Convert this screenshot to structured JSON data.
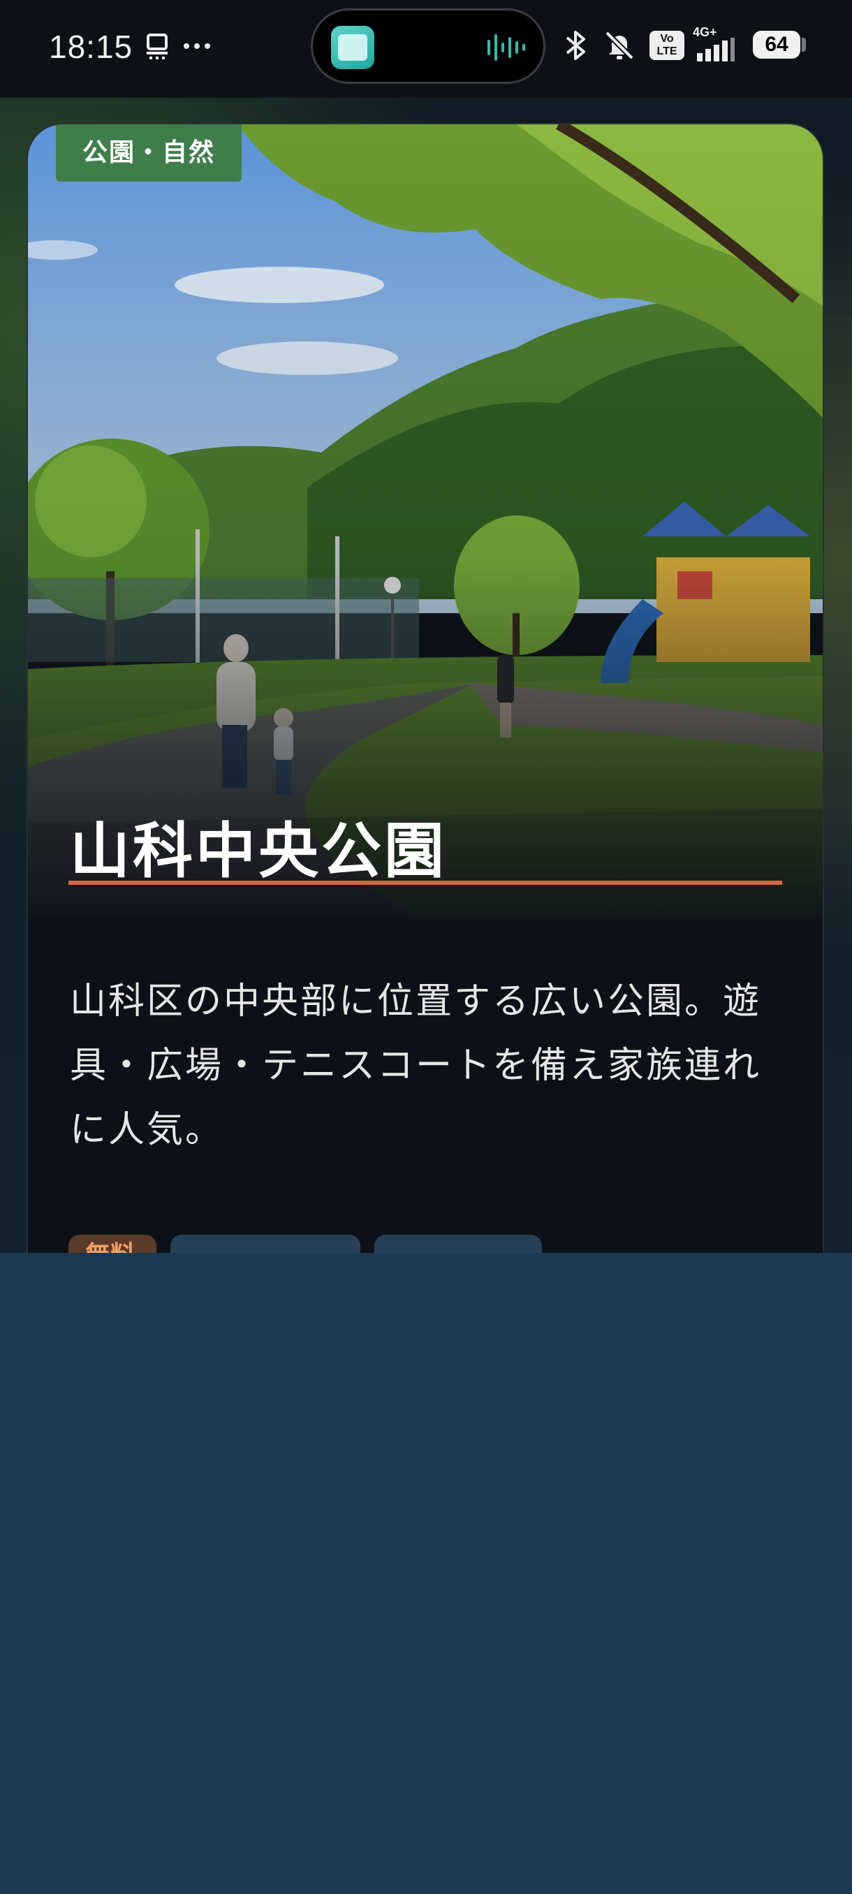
{
  "status_bar": {
    "time": "18:15",
    "battery": "64",
    "network": "4G+",
    "volte": "Vo LTE",
    "icons": [
      "sim-card-icon",
      "more-dots-icon",
      "bluetooth-icon",
      "mute-icon",
      "volte-icon",
      "signal-icon",
      "battery-icon"
    ]
  },
  "dynamic_island": {
    "app_icon": "app-icon",
    "activity_icon": "audio-waveform-icon"
  },
  "card": {
    "category": "公園・自然",
    "title": "山科中央公園",
    "description": "山科区の中央部に位置する広い公園。遊具・広場・テニスコートを備え家族連れに人気。",
    "tags": [
      "無料",
      "",
      ""
    ]
  },
  "colors": {
    "category_badge": "#3f7d4b",
    "title_rule": "#d96540",
    "card_background": "#0d1117",
    "page_background": "#1b3a52",
    "tag_free": "#5a3a2a",
    "tag_other": "#27405a"
  }
}
